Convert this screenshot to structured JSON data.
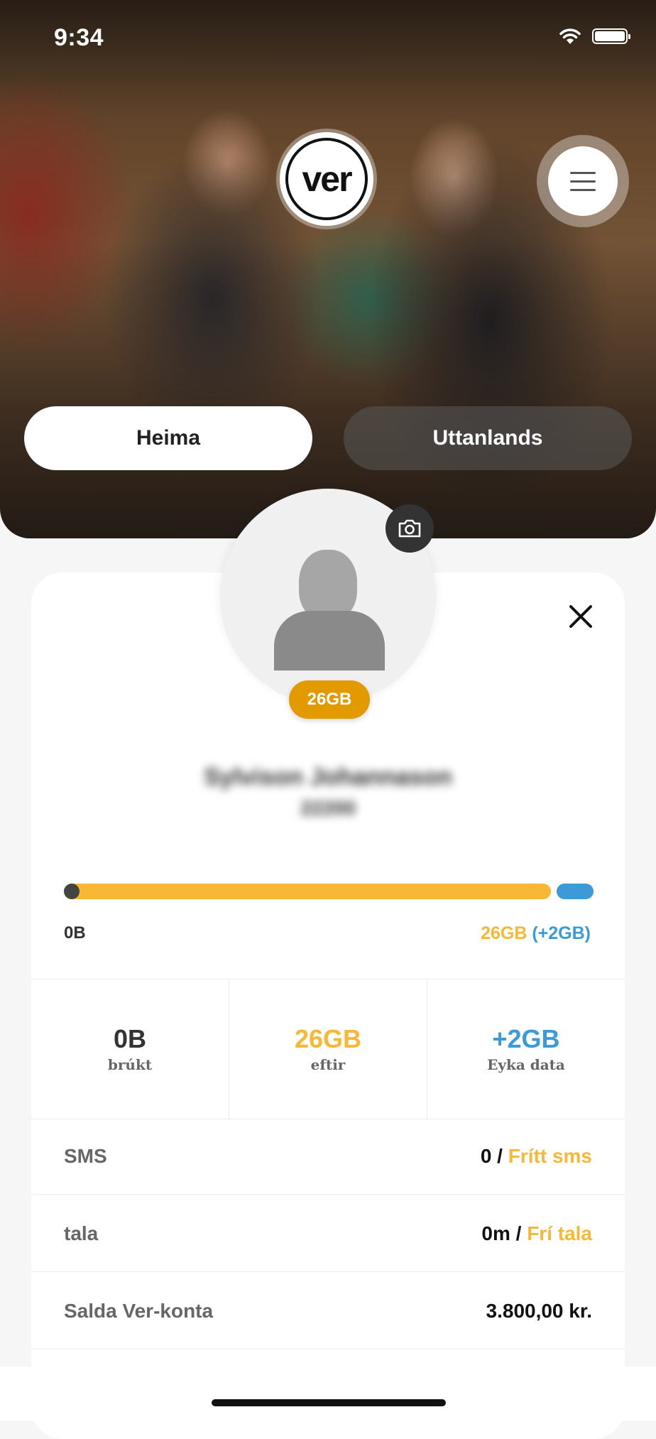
{
  "status_bar": {
    "time": "9:34"
  },
  "header": {
    "logo_text": "ver",
    "tabs": [
      {
        "label": "Heima",
        "selected": true
      },
      {
        "label": "Uttanlands",
        "selected": false
      }
    ]
  },
  "profile": {
    "data_badge": "26GB",
    "name_blurred": "Sylvison Johannason",
    "number_blurred": "22200"
  },
  "usage_bar": {
    "used_fraction": 0.0,
    "remaining_fraction": 0.93,
    "extra_fraction": 0.07,
    "left_label": "0B",
    "right_main": "26GB",
    "right_extra": "(+2GB)",
    "colors": {
      "remaining": "#f8b734",
      "extra": "#3d9ad8",
      "used": "#444444"
    }
  },
  "stats": [
    {
      "value": "0B",
      "label": "brúkt",
      "color": "#333333"
    },
    {
      "value": "26GB",
      "label": "eftir",
      "color": "#f8b734"
    },
    {
      "value": "+2GB",
      "label": "Eyka data",
      "color": "#3d9ad8"
    }
  ],
  "rows": [
    {
      "label": "SMS",
      "value_main": "0 / ",
      "value_accent": "Frítt sms"
    },
    {
      "label": "tala",
      "value_main": "0m / ",
      "value_accent": "Frí tala"
    },
    {
      "label": "Salda Ver-konta",
      "value_main": "3.800,00 kr.",
      "value_accent": ""
    }
  ]
}
